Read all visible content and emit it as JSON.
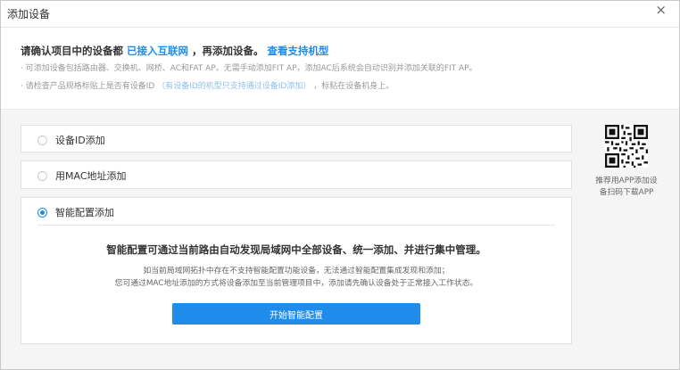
{
  "dialog": {
    "title": "添加设备",
    "close_label": "×"
  },
  "intro": {
    "main_prefix": "请确认项目中的设备都",
    "main_link1": "已接入互联网",
    "main_middle": "，再添加设备。",
    "main_link2": "查看支持机型",
    "note1": "· 可添加设备包括路由器、交换机、网桥、AC和FAT AP。无需手动添加FIT AP，添加AC后系统会自动识别并添加关联的FIT AP。",
    "note2_prefix": "· 请检查产品规格标贴上是否有设备ID",
    "note2_link": "（有设备ID的机型只支持通过设备ID添加）",
    "note2_suffix": "，标贴在设备机身上。"
  },
  "options": [
    {
      "label": "设备ID添加",
      "checked": false
    },
    {
      "label": "用MAC地址添加",
      "checked": false
    },
    {
      "label": "智能配置添加",
      "checked": true
    }
  ],
  "smart_config": {
    "title": "智能配置可通过当前路由自动发现局域网中全部设备、统一添加、并进行集中管理。",
    "desc1": "如当前局域网拓扑中存在不支持智能配置功能设备，无法通过智能配置集成发现和添加；",
    "desc2": "您可通过MAC地址添加的方式将设备添加至当前管理项目中，添加请先确认设备处于正常接入工作状态。",
    "button_label": "开始智能配置"
  },
  "qr_panel": {
    "line1": "推荐用APP添加设",
    "line2": "备扫码下载APP"
  },
  "colors": {
    "accent": "#1f8ceb",
    "background": "#f5f5f5"
  }
}
